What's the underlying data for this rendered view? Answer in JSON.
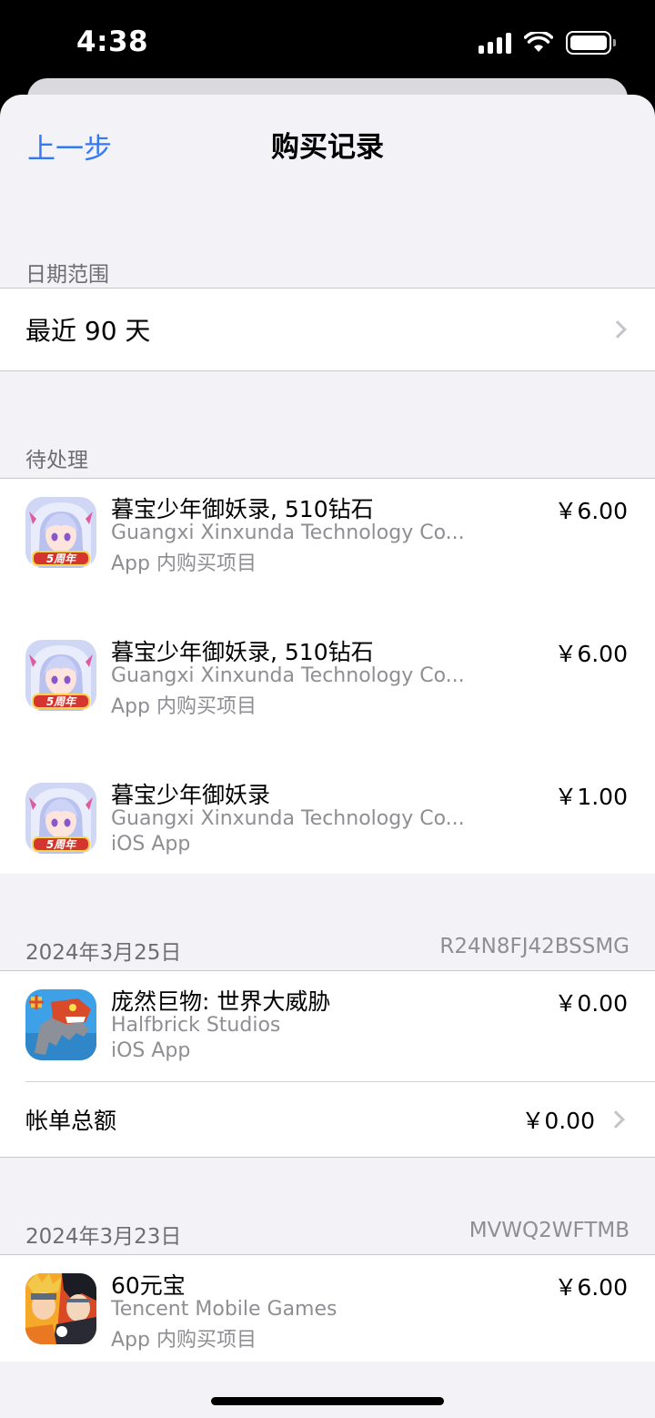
{
  "status_bar": {
    "time": "4:38"
  },
  "nav": {
    "back_label": "上一步",
    "title": "购买记录"
  },
  "date_range": {
    "header": "日期范围",
    "value": "最近 90 天"
  },
  "pending": {
    "header": "待处理",
    "items": [
      {
        "title": "暮宝少年御妖录, 510钻石",
        "developer": "Guangxi Xinxunda Technology Co...",
        "kind": "App 内购买项目",
        "price": "￥6.00",
        "icon": "anime-game-icon"
      },
      {
        "title": "暮宝少年御妖录, 510钻石",
        "developer": "Guangxi Xinxunda Technology Co...",
        "kind": "App 内购买项目",
        "price": "￥6.00",
        "icon": "anime-game-icon"
      },
      {
        "title": "暮宝少年御妖录",
        "developer": "Guangxi Xinxunda Technology Co...",
        "kind": "iOS App",
        "price": "￥1.00",
        "icon": "anime-game-icon"
      }
    ]
  },
  "orders": [
    {
      "date": "2024年3月25日",
      "order_id": "R24N8FJ42BSSMG",
      "items": [
        {
          "title": "庞然巨物: 世界大威胁",
          "developer": "Halfbrick Studios",
          "kind": "iOS App",
          "price": "￥0.00",
          "icon": "robot-dino-icon"
        }
      ],
      "total_label": "帐单总额",
      "total_value": "￥0.00"
    },
    {
      "date": "2024年3月23日",
      "order_id": "MVWQ2WFTMB",
      "items": [
        {
          "title": "60元宝",
          "developer": "Tencent Mobile Games",
          "kind": "App 内购买项目",
          "price": "￥6.00",
          "icon": "ninja-game-icon"
        }
      ]
    }
  ],
  "icon_badge_text": "5周年"
}
